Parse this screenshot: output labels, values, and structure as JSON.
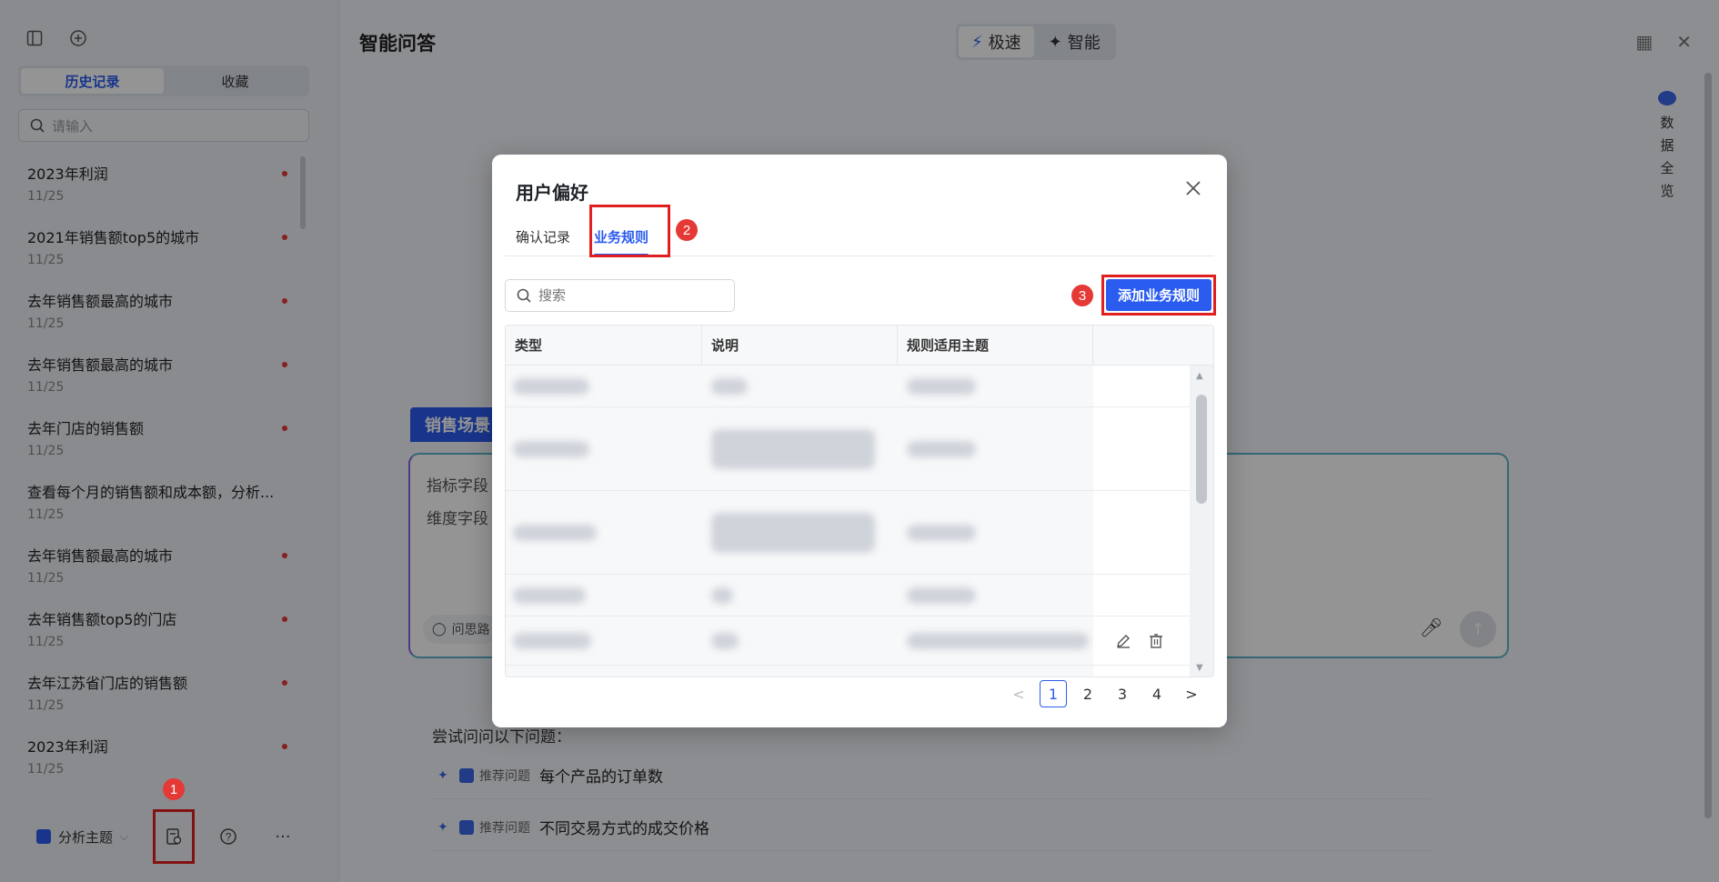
{
  "sidebar": {
    "tabs": [
      "历史记录",
      "收藏"
    ],
    "search_placeholder": "请输入",
    "history": [
      {
        "title": "2023年利润",
        "date": "11/25"
      },
      {
        "title": "2021年销售额top5的城市",
        "date": "11/25"
      },
      {
        "title": "去年销售额最高的城市",
        "date": "11/25"
      },
      {
        "title": "去年销售额最高的城市",
        "date": "11/25"
      },
      {
        "title": "去年门店的销售额",
        "date": "11/25"
      },
      {
        "title": "查看每个月的销售额和成本额，分析...",
        "date": "11/25"
      },
      {
        "title": "去年销售额最高的城市",
        "date": "11/25"
      },
      {
        "title": "去年销售额top5的门店",
        "date": "11/25"
      },
      {
        "title": "去年江苏省门店的销售额",
        "date": "11/25"
      },
      {
        "title": "2023年利润",
        "date": "11/25"
      }
    ],
    "topic_label": "分析主题",
    "more": "···"
  },
  "main": {
    "title": "智能问答",
    "modes": [
      "极速",
      "智能"
    ],
    "overview": [
      "数",
      "据",
      "全",
      "览"
    ],
    "scene_tag": "销售场景",
    "ask_lines": [
      "指标字段",
      "维度字段"
    ],
    "hint": "问思路",
    "try_label": "尝试问问以下问题：",
    "suggestion_tag": "推荐问题",
    "suggestions": [
      "每个产品的订单数",
      "不同交易方式的成交价格"
    ]
  },
  "markers": [
    "1",
    "2",
    "3"
  ],
  "modal": {
    "title": "用户偏好",
    "tabs": [
      "确认记录",
      "业务规则"
    ],
    "search_placeholder": "搜索",
    "add_button": "添加业务规则",
    "columns": [
      "类型",
      "说明",
      "规则适用主题",
      ""
    ],
    "pagination": {
      "pages": [
        "1",
        "2",
        "3",
        "4"
      ],
      "current": 1,
      "prev": "<",
      "next": ">"
    }
  },
  "colors": {
    "accent": "#2b5cf0",
    "highlight": "#e02020"
  }
}
